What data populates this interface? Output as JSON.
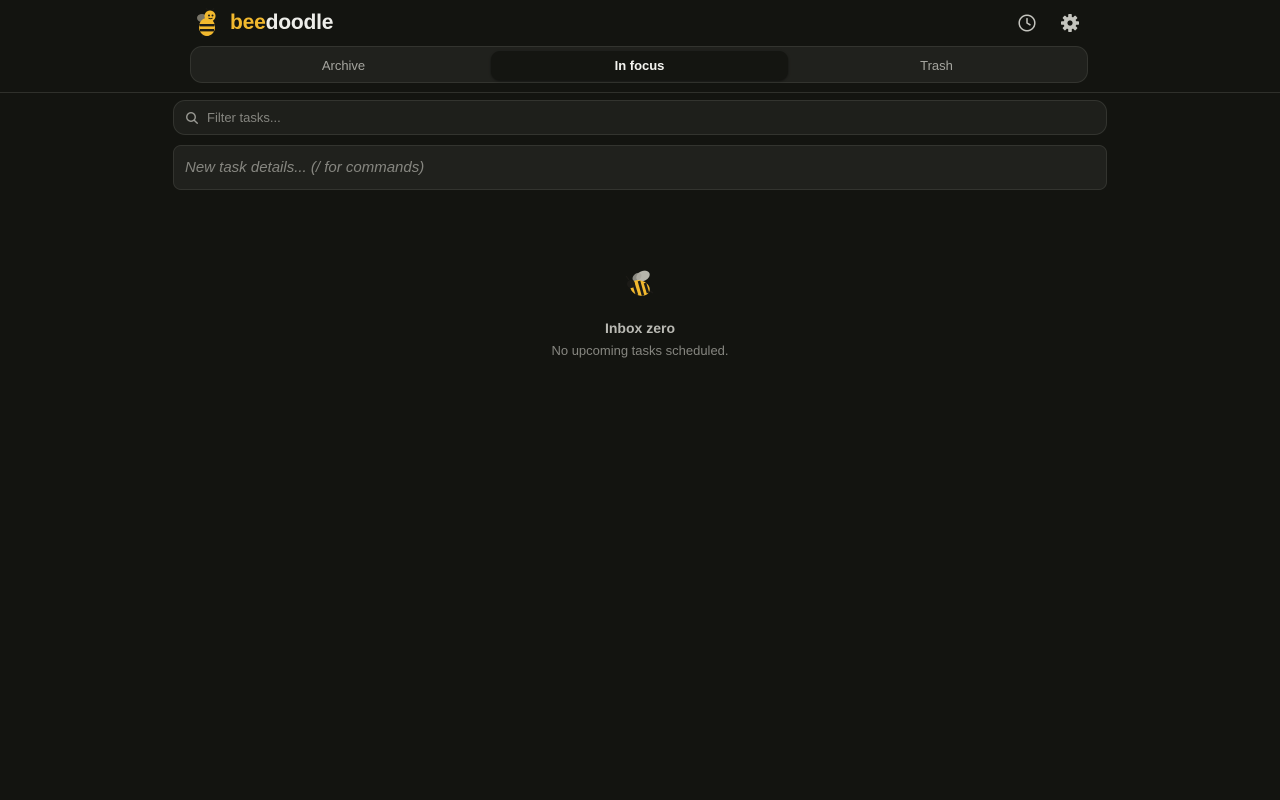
{
  "app": {
    "brand_part1": "bee",
    "brand_part2": "doodle",
    "brand_color": "#f2b92e",
    "logo_icon": "bee-logo-icon"
  },
  "header": {
    "history_icon": "clock-icon",
    "settings_icon": "gear-icon"
  },
  "tabs": [
    {
      "label": "Archive",
      "active": false
    },
    {
      "label": "In focus",
      "active": true
    },
    {
      "label": "Trash",
      "active": false
    }
  ],
  "filter": {
    "placeholder": "Filter tasks...",
    "value": "",
    "icon": "search-icon"
  },
  "new_task": {
    "placeholder": "New task details... (/ for commands)",
    "value": ""
  },
  "empty_state": {
    "icon": "bee-icon",
    "title": "Inbox zero",
    "subtitle": "No upcoming tasks scheduled."
  },
  "colors": {
    "background": "#131410",
    "panel": "#20211d",
    "border": "#33342f",
    "muted_text": "#85857f"
  }
}
